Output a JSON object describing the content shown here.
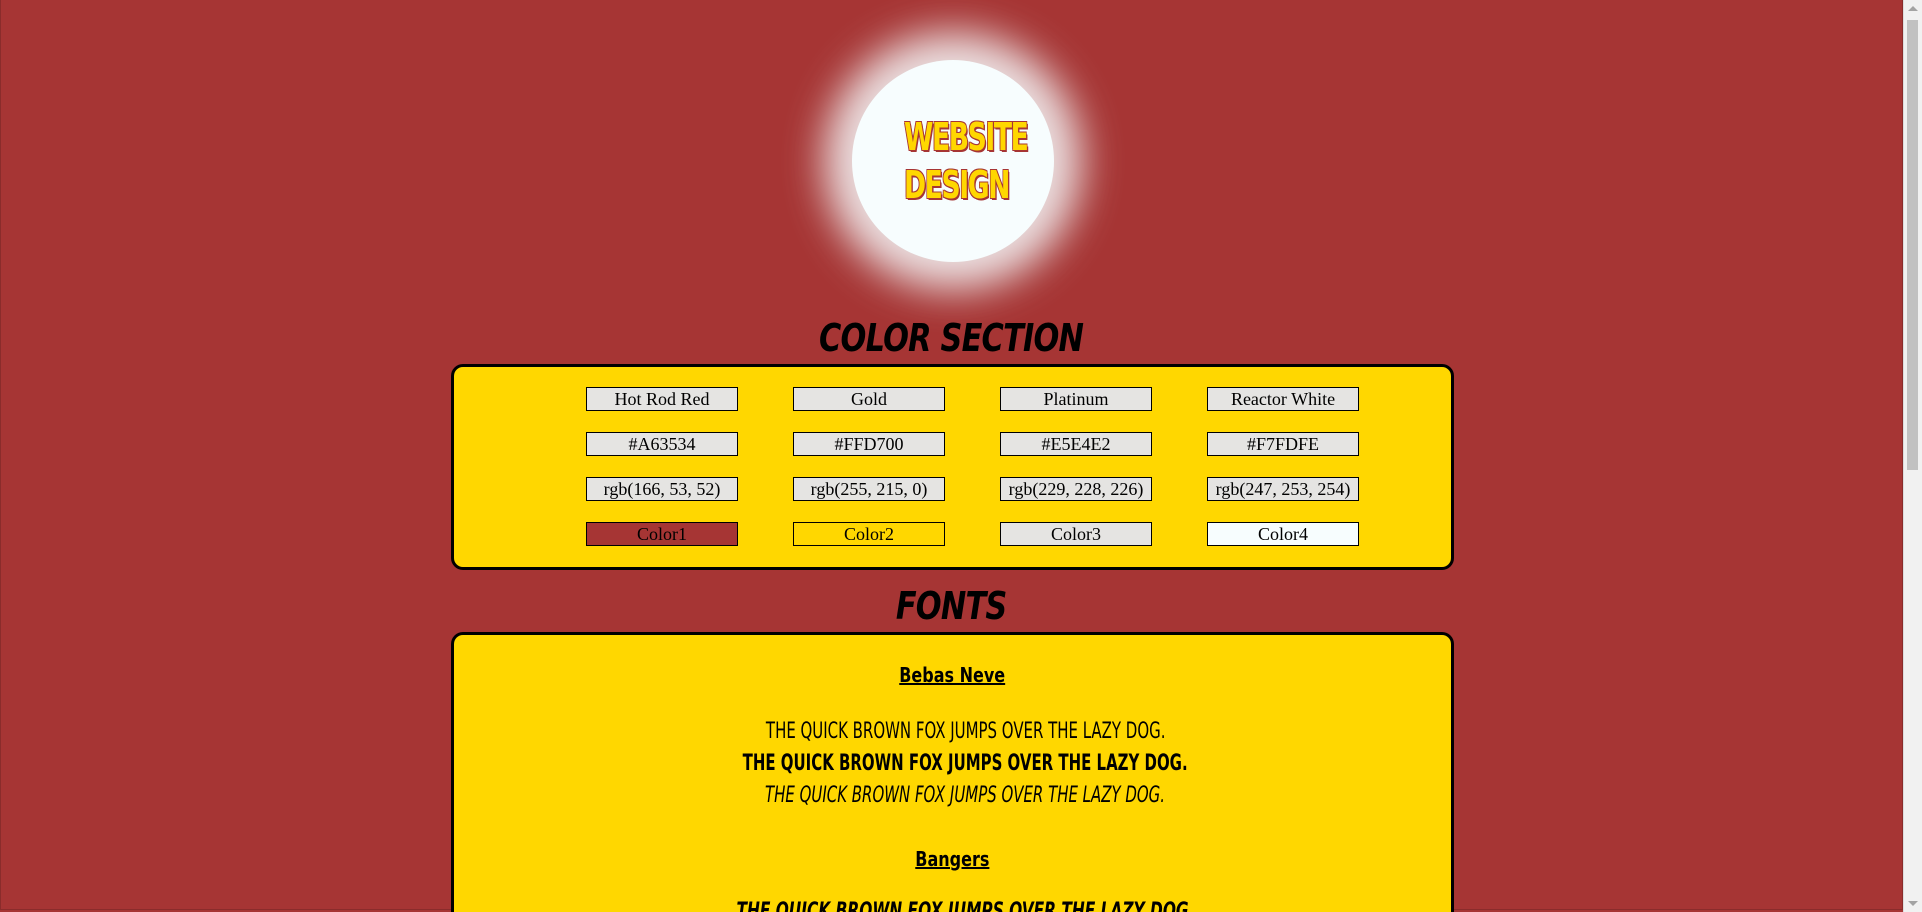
{
  "logo": {
    "line1": "WEBSITE",
    "line2": "DESIGN"
  },
  "color_section": {
    "heading": "COLOR SECTION",
    "names": [
      "Hot Rod Red",
      "Gold",
      "Platinum",
      "Reactor White"
    ],
    "hex": [
      "#A63534",
      "#FFD700",
      "#E5E4E2",
      "#F7FDFE"
    ],
    "rgb": [
      "rgb(166, 53, 52)",
      "rgb(255, 215, 0)",
      "rgb(229, 228, 226)",
      "rgb(247, 253, 254)"
    ],
    "swatch_labels": [
      "Color1",
      "Color2",
      "Color3",
      "Color4"
    ],
    "swatch_colors": [
      "#A63534",
      "#FFD700",
      "#E5E4E2",
      "#F7FDFE"
    ]
  },
  "fonts_section": {
    "heading": "FONTS",
    "fonts": [
      {
        "name": "Bebas Neve",
        "samples": [
          "THE QUICK BROWN FOX JUMPS OVER THE LAZY DOG.",
          "THE QUICK BROWN FOX JUMPS OVER THE LAZY DOG.",
          "THE QUICK BROWN FOX JUMPS OVER THE LAZY DOG."
        ]
      },
      {
        "name": "Bangers",
        "samples": [
          "THE QUICK BROWN FOX JUMPS OVER THE LAZY DOG."
        ]
      }
    ]
  },
  "colors": {
    "background": "#A63534",
    "panel": "#FFD700",
    "logo_circle": "#F7FDFE"
  }
}
